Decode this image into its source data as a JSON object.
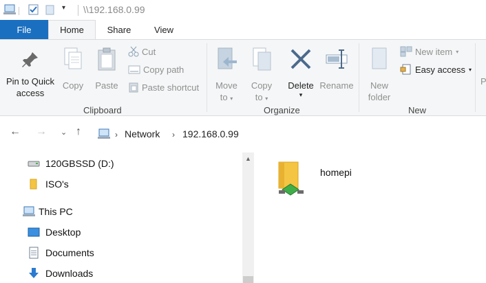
{
  "window": {
    "title": "\\\\192.168.0.99"
  },
  "ribbon_tabs": {
    "file": "File",
    "home": "Home",
    "share": "Share",
    "view": "View"
  },
  "clipboard": {
    "group_label": "Clipboard",
    "pin_line1": "Pin to Quick",
    "pin_line2": "access",
    "copy": "Copy",
    "paste": "Paste",
    "cut": "Cut",
    "copy_path": "Copy path",
    "paste_shortcut": "Paste shortcut"
  },
  "organize": {
    "group_label": "Organize",
    "move_line1": "Move",
    "move_line2": "to",
    "copy_line1": "Copy",
    "copy_line2": "to",
    "delete": "Delete",
    "rename": "Rename"
  },
  "new_group": {
    "group_label": "New",
    "new_folder_line1": "New",
    "new_folder_line2": "folder",
    "new_item": "New item",
    "easy_access": "Easy access"
  },
  "address": {
    "segments": [
      "Network",
      "192.168.0.99"
    ]
  },
  "nav_pane": {
    "items": [
      {
        "label": "120GBSSD (D:)"
      },
      {
        "label": "ISO's"
      },
      {
        "label": "This PC"
      },
      {
        "label": "Desktop"
      },
      {
        "label": "Documents"
      },
      {
        "label": "Downloads"
      }
    ]
  },
  "content": {
    "items": [
      {
        "label": "homepi"
      }
    ]
  },
  "colors": {
    "accent": "#1a6fc0",
    "ribbon_bg": "#f5f6f7",
    "folder": "#f4c542"
  }
}
